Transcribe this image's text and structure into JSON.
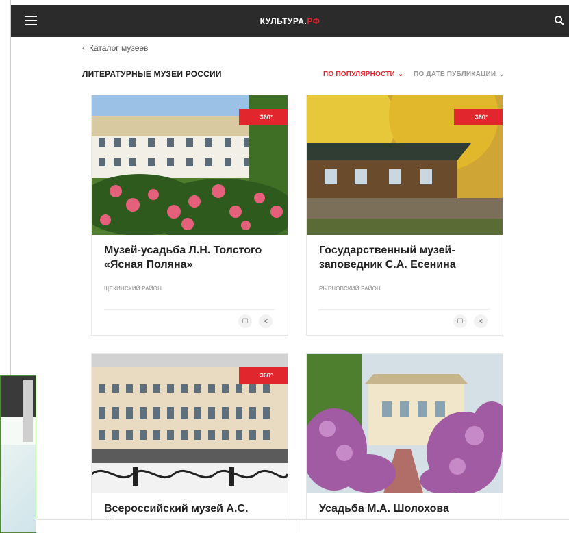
{
  "header": {
    "logo_main": "КУЛЬТУРА.",
    "logo_accent": "РФ",
    "menu_icon": "hamburger-icon",
    "search_icon": "search-icon"
  },
  "breadcrumb": {
    "label": "Каталог музеев"
  },
  "page": {
    "title": "ЛИТЕРАТУРНЫЕ МУЗЕИ РОССИИ"
  },
  "sort": {
    "popular": "ПО ПОПУЛЯРНОСТИ",
    "date": "ПО ДАТЕ ПУБЛИКАЦИИ"
  },
  "badge": "360°",
  "cards": [
    {
      "name": "Музей-усадьба Л.Н. Толстого «Ясная Поляна»",
      "region": "ЩЕКИНСКИЙ РАЙОН",
      "has360": true
    },
    {
      "name": "Государственный музей-заповедник С.А. Есенина",
      "region": "РЫБНОВСКИЙ РАЙОН",
      "has360": true
    },
    {
      "name": "Всероссийский музей А.С. Пушкина",
      "region": "",
      "has360": true
    },
    {
      "name": "Усадьба М.А. Шолохова",
      "region": "",
      "has360": false
    }
  ],
  "colors": {
    "accent": "#e1262d",
    "topbar": "#2b2b2b"
  }
}
